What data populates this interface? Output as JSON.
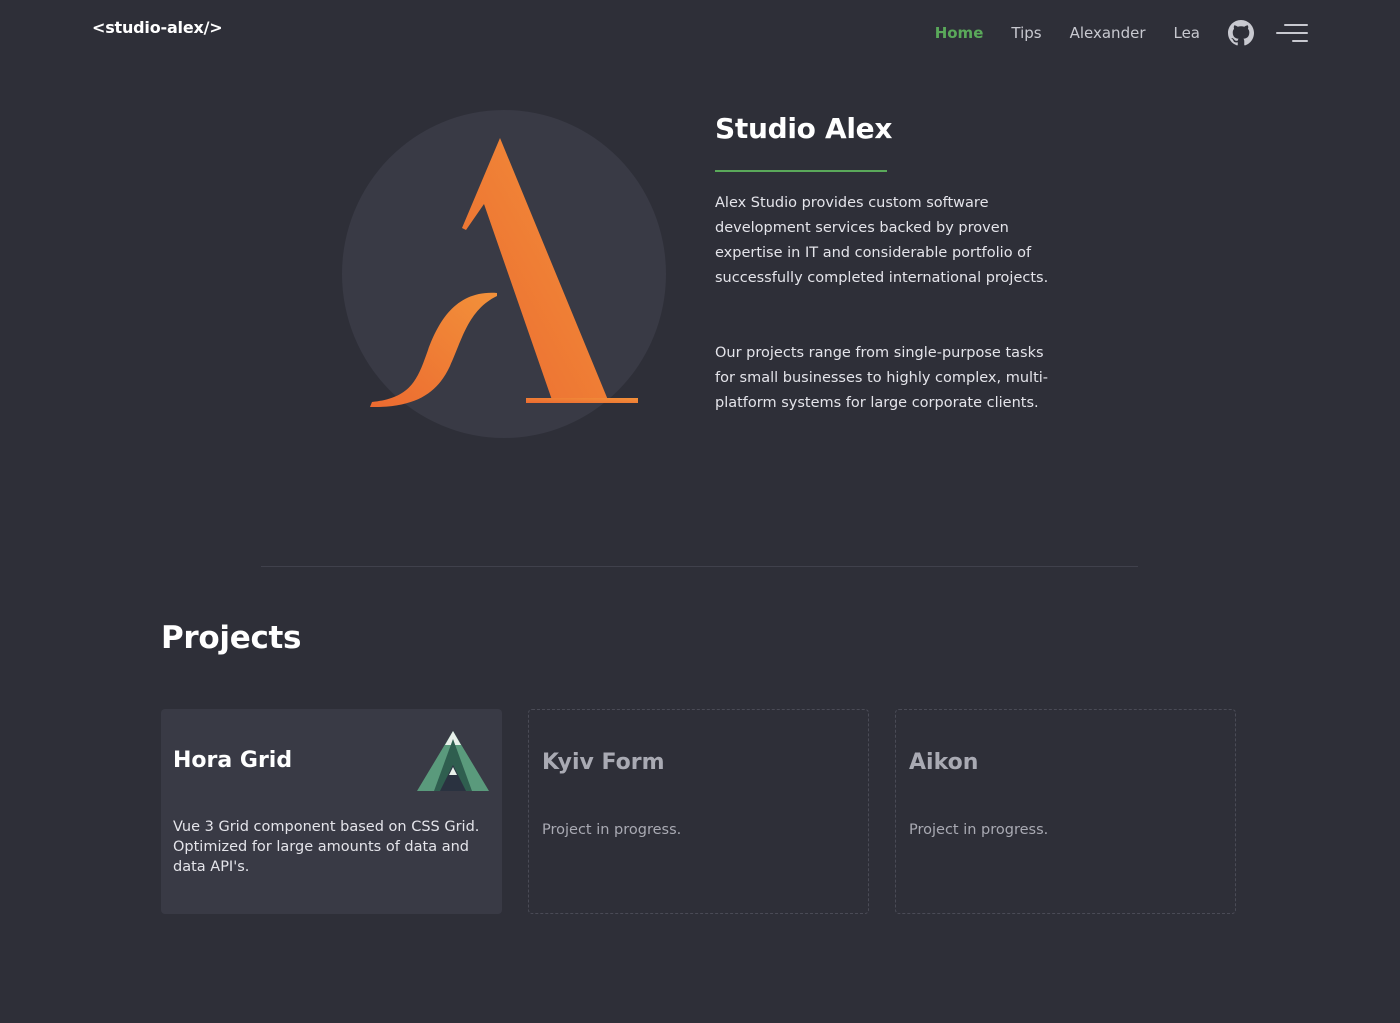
{
  "nav": {
    "logo": "<studio-alex/>",
    "links": [
      {
        "label": "Home",
        "active": true
      },
      {
        "label": "Tips",
        "active": false
      },
      {
        "label": "Alexander",
        "active": false
      },
      {
        "label": "Lea",
        "active": false
      }
    ],
    "icons": [
      "github-icon",
      "menu-icon"
    ]
  },
  "hero": {
    "title": "Studio Alex",
    "paragraph1": "Alex Studio provides custom software development services backed by proven expertise in IT and considerable portfolio of successfully completed international projects.",
    "paragraph2": "Our projects range from single-purpose tasks for small businesses to highly complex, multi-platform systems for large corporate clients."
  },
  "projects": {
    "heading": "Projects",
    "items": [
      {
        "title": "Hora Grid",
        "description": "Vue 3 Grid component based on CSS Grid. Optimized for large amounts of data and data API's.",
        "icon": "hora-grid-logo"
      },
      {
        "title": "Kyiv Form",
        "description": "Project in progress."
      },
      {
        "title": "Aikon",
        "description": "Project in progress."
      }
    ]
  },
  "colors": {
    "background": "#2e2f38",
    "card": "#393a45",
    "accent": "#5aa95a",
    "logo_orange": "#f08a35"
  }
}
